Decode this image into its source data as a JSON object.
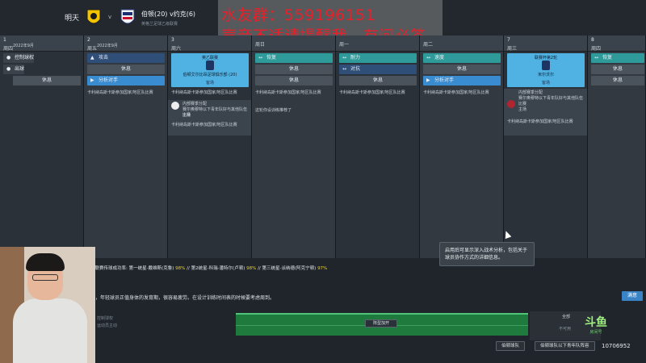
{
  "header": {
    "tomorrow": "明天",
    "vs": "v",
    "match": "伯顿(20) v约克(6)",
    "competition": "英格兰足球乙级联赛"
  },
  "overlay": {
    "line1": "水友群：559196151",
    "line2": "声音不适请提醒我，有问必答"
  },
  "columns": [
    {
      "num": "1",
      "day": "周四",
      "month": "2022年9月",
      "slots": [
        {
          "label": "控制球权",
          "style": "grey-plain"
        },
        {
          "label": "出球",
          "style": "grey-plain"
        },
        {
          "label": "休息",
          "style": "rest"
        }
      ]
    },
    {
      "num": "2",
      "day": "周五",
      "month": "2022年9月",
      "slots": [
        {
          "label": "攻击",
          "style": "dark"
        },
        {
          "label": "休息",
          "style": "rest"
        },
        {
          "label": "分析对手",
          "style": "dark"
        }
      ],
      "note": "卡利纳岛斯卡斯参加国家/地区队比赛"
    },
    {
      "num": "3",
      "day": "周六",
      "match": {
        "comp": "英乙联赛",
        "team": "伯顿艾尔比昂足球俱乐部 (20)",
        "venue": "客场"
      },
      "note": "卡利纳岛斯卡斯参加国家/地区队比赛",
      "note2_title": "内部赛季分配",
      "note2": "赛尔奥穆特以下青年队好与其他队伍比赛",
      "note2b": "主场",
      "note3": "卡利纳岛斯卡斯参加国家/地区队比赛"
    },
    {
      "num": "",
      "day": "周日",
      "slots": [
        {
          "label": "恢复",
          "style": "teal"
        },
        {
          "label": "休息",
          "style": "rest"
        },
        {
          "label": "休息",
          "style": "rest"
        }
      ],
      "note": "卡利纳岛斯卡斯参加国家/地区队比赛",
      "note2": "这轮你设训练推荐了"
    },
    {
      "num": "",
      "day": "周一",
      "slots": [
        {
          "label": "耐力",
          "style": "teal"
        },
        {
          "label": "对抗",
          "style": "dark"
        },
        {
          "label": "休息",
          "style": "rest"
        }
      ],
      "note": "卡利纳岛斯卡斯参加国家/地区队比赛"
    },
    {
      "num": "",
      "day": "周二",
      "slots": [
        {
          "label": "速度",
          "style": "teal"
        },
        {
          "label": "休息",
          "style": "rest"
        },
        {
          "label": "分析对手",
          "style": "blue"
        }
      ],
      "note": "卡利纳岛斯卡斯参加国家/地区队比赛"
    },
    {
      "num": "7",
      "day": "周三",
      "match": {
        "comp": "联赛杯第2轮",
        "team": "米尔沃尔",
        "venue": "客场"
      },
      "note_title": "内部赛季分配",
      "note": "赛尔奥穆特以下青年队好与其他队伍比赛",
      "note2b": "主场",
      "note3": "卡利纳岛斯卡斯参加国家/地区队比赛"
    },
    {
      "num": "8",
      "day": "周四",
      "slots": [
        {
          "label": "恢复",
          "style": "teal"
        },
        {
          "label": "休息",
          "style": "rest"
        },
        {
          "label": "休息",
          "style": "rest"
        }
      ]
    }
  ],
  "tooltip": "启用后可显示深入战术分析，包括关于球员协作方式的详细信息。",
  "stats": {
    "prefix": "乙联赛传球成功率: 第一统星-戴维斯(克鲁)",
    "v1": "98%",
    "mid1": " // 第2统星-科瑞-潘特尔(卢顿)",
    "v2": "98%",
    "mid2": " // 第三统星-派纳德(阿克宁顿)",
    "v3": "97%"
  },
  "advice": "主，年轻球员正值身体的发育期，很容易疲劳。在设计训练时间表的时候要考虑周到。",
  "apply_label": "满意",
  "pitch_button": "阵型加开",
  "right_panel": {
    "a": "全部",
    "b": "不可用"
  },
  "left_text": {
    "a": "控制球权",
    "b": "运动员主动"
  },
  "bottom_buttons": {
    "b1": "伯顿球队",
    "b2": "伯顿球队以下青年队阵容"
  },
  "logo": {
    "big": "斗鱼",
    "small": "房间号"
  },
  "room_id": "10706952"
}
